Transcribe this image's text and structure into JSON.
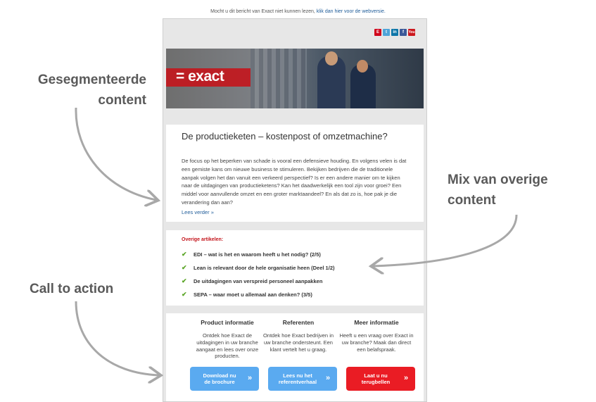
{
  "notice": {
    "text": "Mocht u dit bericht van Exact niet kunnen lezen,",
    "link": "klik dan hier voor de webversie."
  },
  "social_icons": [
    {
      "name": "exact-icon",
      "glyph": "E"
    },
    {
      "name": "twitter-icon",
      "glyph": "t"
    },
    {
      "name": "linkedin-icon",
      "glyph": "in"
    },
    {
      "name": "facebook-icon",
      "glyph": "f"
    },
    {
      "name": "youtube-icon",
      "glyph": "You"
    }
  ],
  "banner": {
    "logo": "= exact"
  },
  "article": {
    "title": "De productieketen – kostenpost of omzetmachine?",
    "body": "De focus op het beperken van schade is vooral een defensieve houding. En volgens velen is dat een gemiste kans om nieuwe business te stimuleren. Bekijken bedrijven die de traditionele aanpak volgen het dan vanuit een verkeerd perspectief? Is er een andere manier om te kijken naar de uitdagingen van productieketens? Kan het daadwerkelijk een tool zijn voor groei? Een middel voor aanvullende omzet en een groter marktaandeel? En als dat zo is, hoe pak je die verandering dan aan?",
    "more": "Lees verder »"
  },
  "other": {
    "heading": "Overige artikelen:",
    "items": [
      "EDI – wat is het en waarom heeft u het nodig? (2/5)",
      "Lean is relevant door de hele organisatie heen (Deel 1/2)",
      "De uitdagingen van verspreid personeel aanpakken",
      "SEPA – waar moet u allemaal aan denken? (3/5)"
    ]
  },
  "cta": {
    "columns": [
      {
        "title": "Product informatie",
        "text": "Ontdek hoe Exact de uitdagingen in uw branche aangaat en lees over onze producten.",
        "button": [
          "Download nu",
          "de brochure"
        ]
      },
      {
        "title": "Referenten",
        "text": "Ontdek hoe Exact bedrijven in uw branche ondersteunt. Een klant vertelt het u graag.",
        "button": [
          "Lees nu het",
          "referentverhaal"
        ]
      },
      {
        "title": "Meer informatie",
        "text": "Heeft u een vraag over Exact in uw branche? Maak dan direct een belafspraak.",
        "button": [
          "Laat u nu",
          "terugbellen"
        ]
      }
    ],
    "arrow": "»"
  },
  "annotations": {
    "segmented": [
      "Gesegmenteerde",
      "content"
    ],
    "mix": [
      "Mix van overige",
      "content"
    ],
    "cta": "Call to action"
  },
  "colors": {
    "accent_red": "#c4151c",
    "link_blue": "#1f5c99",
    "check_green": "#5aa526",
    "button_blue": "#5aaaf0",
    "button_red": "#ea1c24"
  }
}
